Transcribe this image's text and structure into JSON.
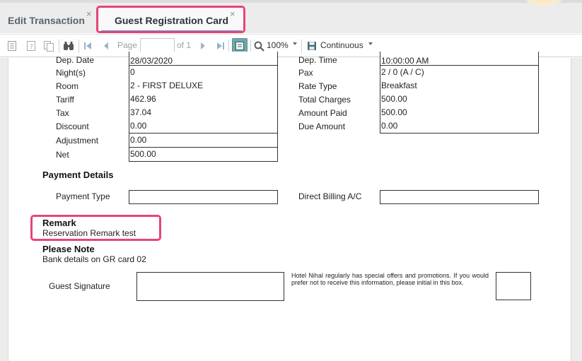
{
  "tabs": [
    {
      "label": "Edit Transaction",
      "active": false
    },
    {
      "label": "Guest Registration Card",
      "active": true
    }
  ],
  "tab_close_glyph": "×",
  "toolbar": {
    "page_label": "Page",
    "page_value": "",
    "of_label": "of 1",
    "zoom": "100%",
    "view_mode": "Continuous"
  },
  "details": {
    "left": [
      {
        "label": "Dep. Date",
        "value": "28/03/2020"
      },
      {
        "label": "Night(s)",
        "value": "0"
      },
      {
        "label": "Room",
        "value": "2 - FIRST DELUXE"
      },
      {
        "label": "Tariff",
        "value": "462.96"
      },
      {
        "label": "Tax",
        "value": "37.04"
      },
      {
        "label": "Discount",
        "value": "0.00"
      },
      {
        "label": "Adjustment",
        "value": "0.00"
      },
      {
        "label": "Net",
        "value": "500.00"
      }
    ],
    "right": [
      {
        "label": "Dep. Time",
        "value": "10:00:00 AM"
      },
      {
        "label": "Pax",
        "value": "2 / 0 (A / C)"
      },
      {
        "label": "Rate Type",
        "value": "Breakfast"
      },
      {
        "label": "Total Charges",
        "value": "500.00"
      },
      {
        "label": "Amount Paid",
        "value": "500.00"
      },
      {
        "label": "Due Amount",
        "value": "0.00"
      }
    ]
  },
  "payment": {
    "title": "Payment Details",
    "payment_type_label": "Payment Type",
    "payment_type_value": "",
    "billing_label": "Direct Billing A/C",
    "billing_value": ""
  },
  "remark": {
    "title": "Remark",
    "text": "Reservation Remark test"
  },
  "note": {
    "title": "Please Note",
    "text": "Bank details on GR card 02"
  },
  "signature": {
    "label": "Guest Signature",
    "offers_text": "Hotel Nihal regularly has special offers and promotions. If you would prefer not to receive this information, please initial in this box."
  },
  "colors": {
    "highlight": "#e8447a",
    "active_underline": "#5b8fd9"
  }
}
